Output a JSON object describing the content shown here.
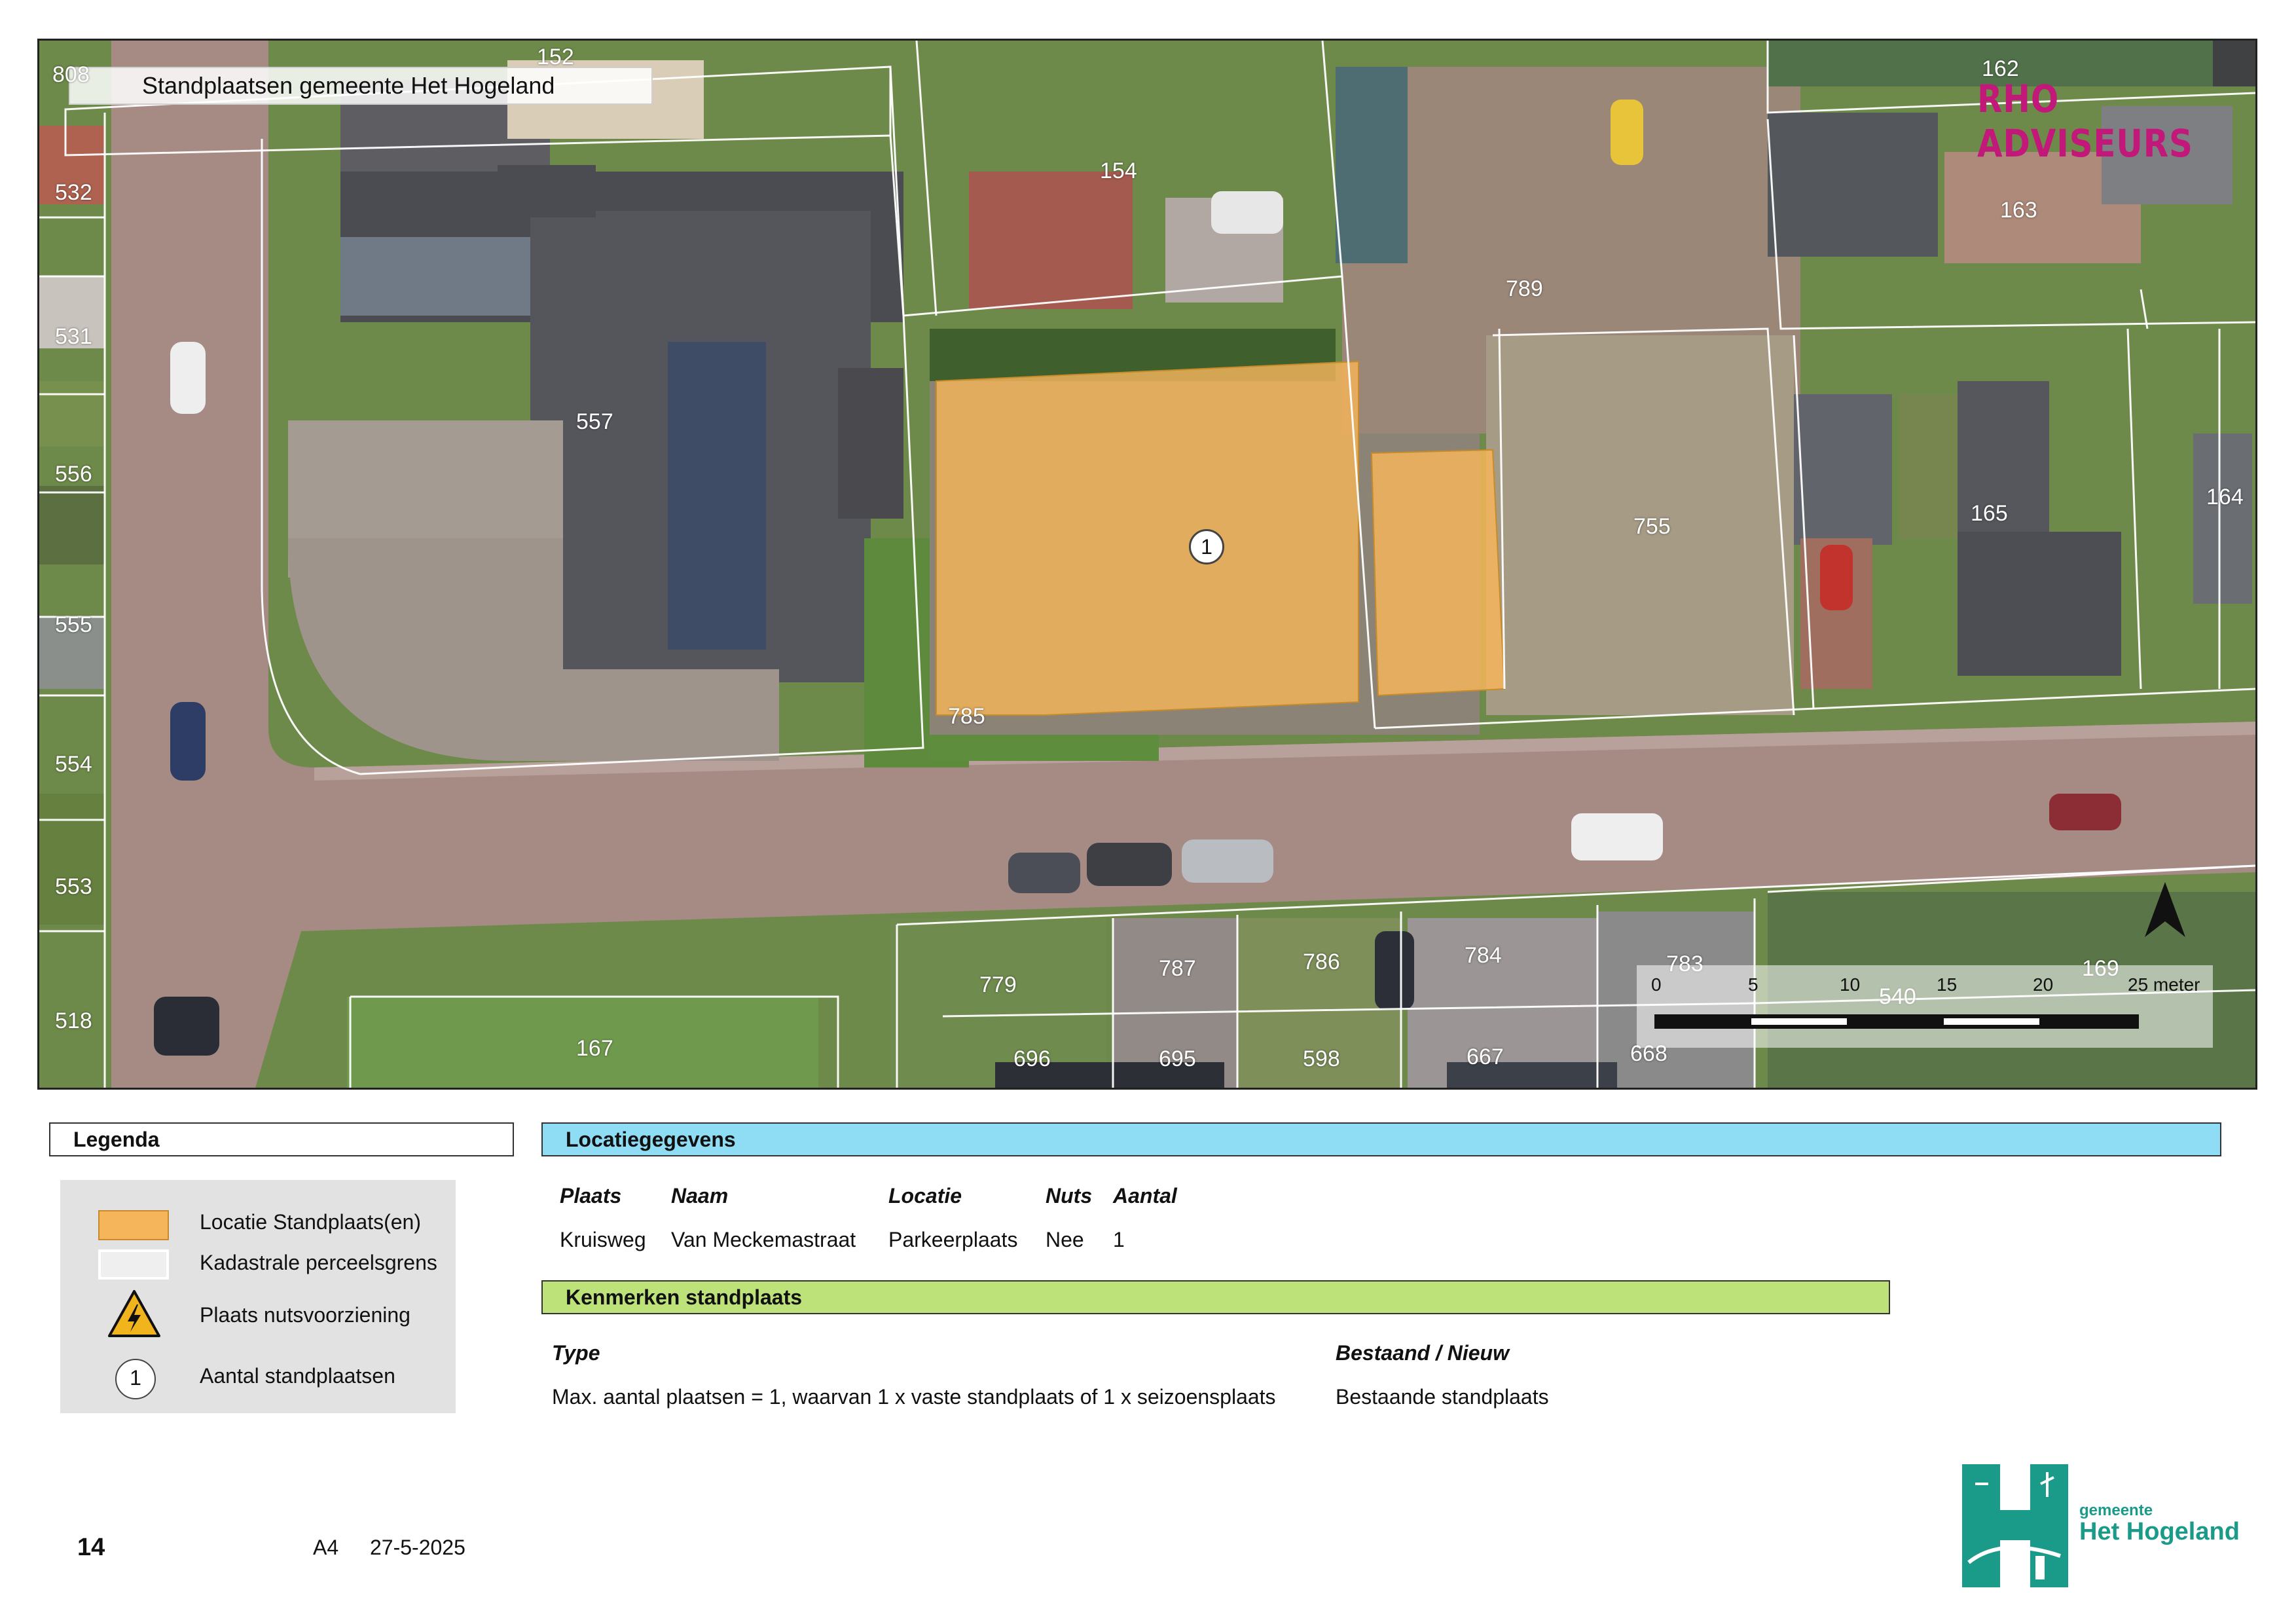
{
  "map": {
    "title": "Standplaatsen gemeente Het Hogeland",
    "brand": "RHO ADVISEURS",
    "marker_count": "1",
    "parcels": [
      "808",
      "152",
      "532",
      "531",
      "556",
      "555",
      "554",
      "553",
      "518",
      "557",
      "154",
      "789",
      "162",
      "163",
      "755",
      "165",
      "164",
      "785",
      "779",
      "787",
      "786",
      "784",
      "783",
      "540",
      "169",
      "696",
      "695",
      "598",
      "667",
      "668",
      "167"
    ],
    "scale": {
      "ticks": [
        "0",
        "5",
        "10",
        "15",
        "20",
        "25 meter"
      ]
    },
    "north_arrow": "north-arrow"
  },
  "legend": {
    "header": "Legenda",
    "items": [
      {
        "label": "Locatie Standplaats(en)",
        "color": "#f5b55a"
      },
      {
        "label": "Kadastrale perceelsgrens",
        "color": "#ffffff"
      },
      {
        "label": "Plaats nutsvoorziening",
        "icon": "electric-hazard-icon"
      },
      {
        "label": "Aantal standplaatsen",
        "symbol": "1"
      }
    ]
  },
  "location": {
    "header": "Locatiegegevens",
    "header_color": "#8fdcf5",
    "columns": [
      "Plaats",
      "Naam",
      "Locatie",
      "Nuts",
      "Aantal"
    ],
    "row": [
      "Kruisweg",
      "Van Meckemastraat",
      "Parkeerplaats",
      "Nee",
      "1"
    ]
  },
  "features": {
    "header": "Kenmerken standplaats",
    "header_color": "#bde27a",
    "columns": [
      "Type",
      "Bestaand / Nieuw"
    ],
    "row": [
      "Max. aantal plaatsen = 1, waarvan 1 x vaste standplaats of 1 x seizoensplaats",
      "Bestaande standplaats"
    ]
  },
  "footer": {
    "page": "14",
    "paper": "A4",
    "date": "27-5-2025"
  },
  "logo": {
    "line1": "gemeente",
    "line2": "Het Hogeland",
    "color": "#1a9b8a"
  }
}
